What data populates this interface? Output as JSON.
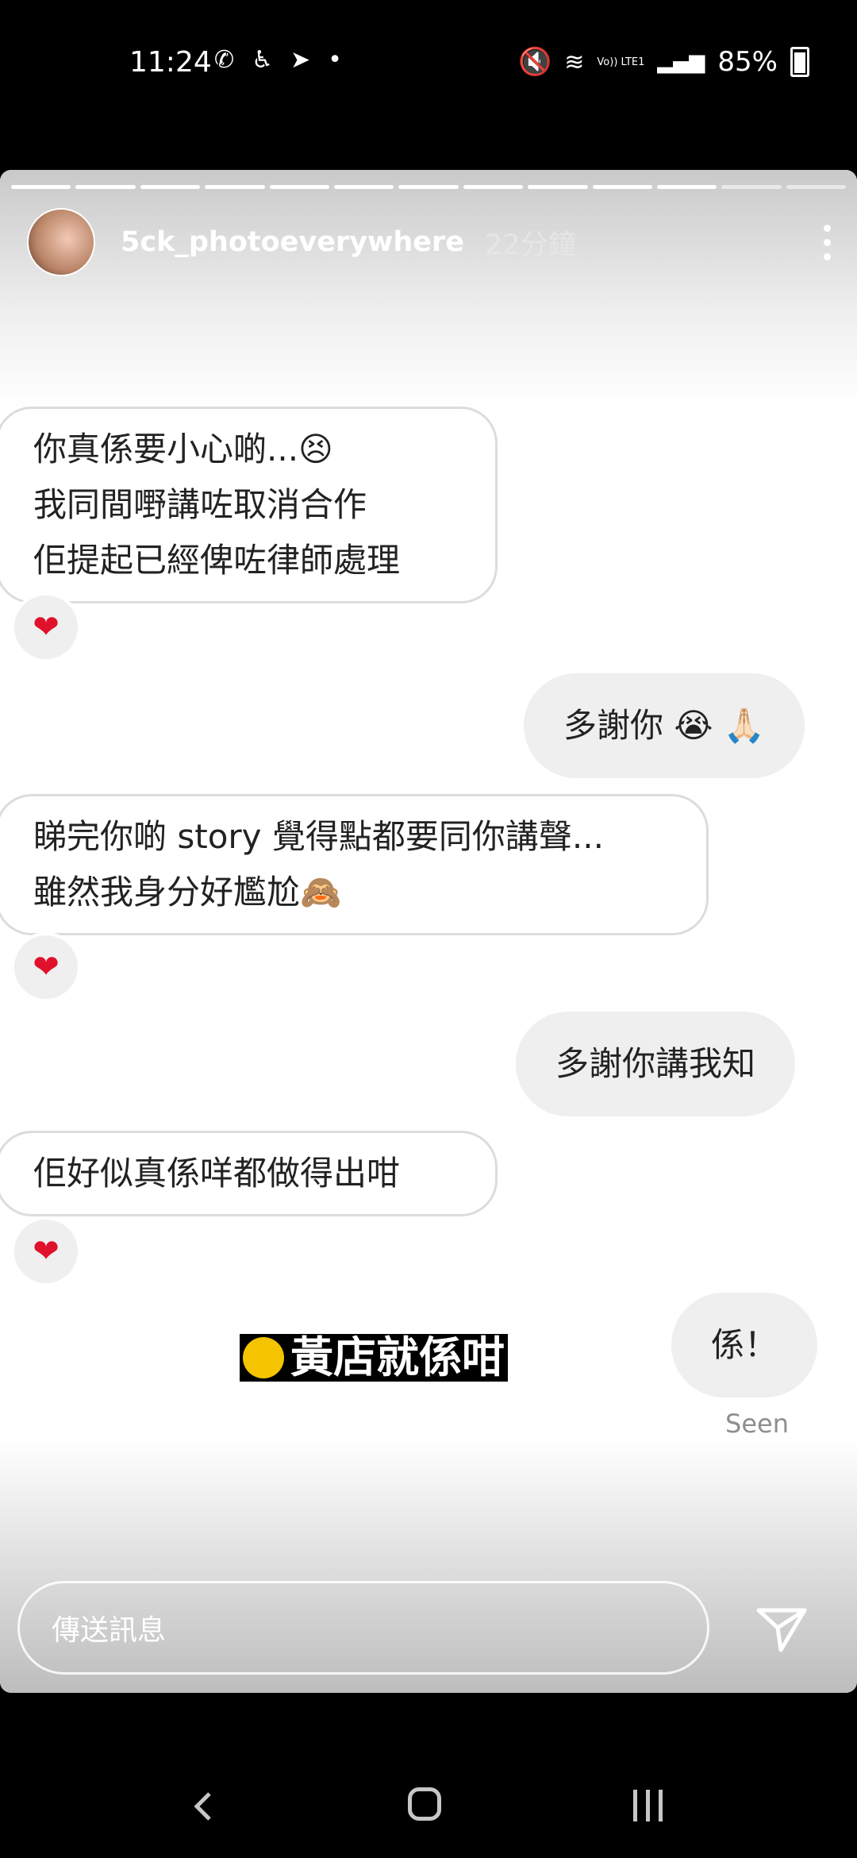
{
  "status_bar": {
    "time": "11:24",
    "battery": "85%",
    "network_label": "Vo)) LTE1"
  },
  "story": {
    "username": "5ck_photoeverywhere",
    "time_ago": "22分鐘",
    "progress_segments_total": 13,
    "progress_segments_done": 11
  },
  "messages": [
    {
      "side": "in",
      "lines": [
        "你真係要小心啲...😣",
        "我同間嘢講咗取消合作",
        "佢提起已經俾咗律師處理"
      ],
      "reaction": "❤"
    },
    {
      "side": "out",
      "text": "多謝你 😭 🙏🏻"
    },
    {
      "side": "in",
      "lines": [
        "睇完你啲 story 覺得點都要同你講聲...",
        "雖然我身分好尷尬🙈"
      ],
      "reaction": "❤"
    },
    {
      "side": "out",
      "text": "多謝你講我知"
    },
    {
      "side": "in",
      "lines": [
        "佢好似真係咩都做得出咁"
      ],
      "reaction": "❤"
    },
    {
      "side": "out",
      "text": "係！"
    }
  ],
  "seen_label": "Seen",
  "sticker_text": "黃店就係咁",
  "reply": {
    "placeholder": "傳送訊息"
  },
  "icons": {
    "send": "send-icon",
    "more": "more-vertical-icon",
    "back": "nav-back-icon",
    "home": "nav-home-icon",
    "recents": "nav-recents-icon"
  }
}
